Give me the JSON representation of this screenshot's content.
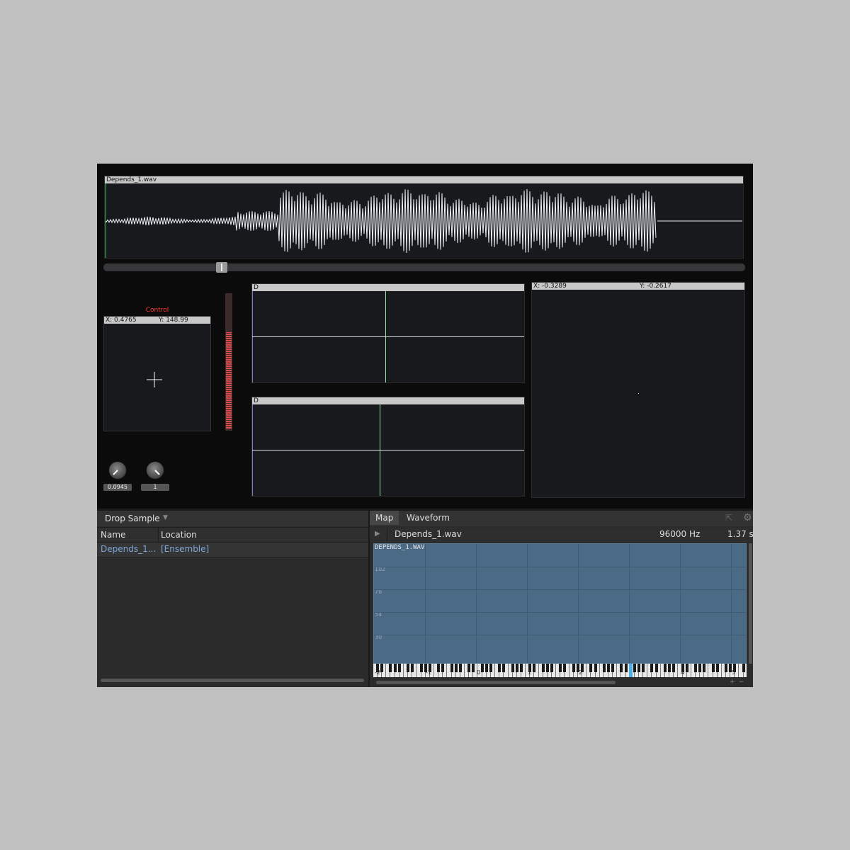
{
  "waveform": {
    "title": "Depends_1.wav"
  },
  "xy_pad": {
    "label": "Control",
    "x_readout": "X: 0.4765",
    "y_readout": "Y: 148.99"
  },
  "knobs": [
    {
      "value": "0.0945"
    },
    {
      "value": "1"
    }
  ],
  "scope1": {
    "header": "D"
  },
  "scope2": {
    "header": "D"
  },
  "large_plot": {
    "x_readout": "X: -0.3289",
    "y_readout": "Y: -0.2617"
  },
  "sample_list": {
    "dropdown_label": "Drop Sample",
    "columns": [
      "Name",
      "Location"
    ],
    "rows": [
      {
        "name": "Depends_1....",
        "location": "[Ensemble]"
      }
    ]
  },
  "editor": {
    "tabs": [
      "Map",
      "Waveform"
    ],
    "active_tab": "Map",
    "file_name": "Depends_1.wav",
    "sample_rate": "96000 Hz",
    "duration": "1.37 s",
    "map_title": "DEPENDS_1.WAV",
    "map_rows": [
      "102",
      "78",
      "54",
      "30"
    ],
    "octave_labels": [
      "-2",
      "-1",
      "0",
      "1",
      "2",
      "",
      "4",
      "5"
    ]
  },
  "colors": {
    "accent": "#ff3b30",
    "link": "#7ea6d8",
    "map_fill": "#4b6a85",
    "key_highlight": "#4fb0e8"
  }
}
